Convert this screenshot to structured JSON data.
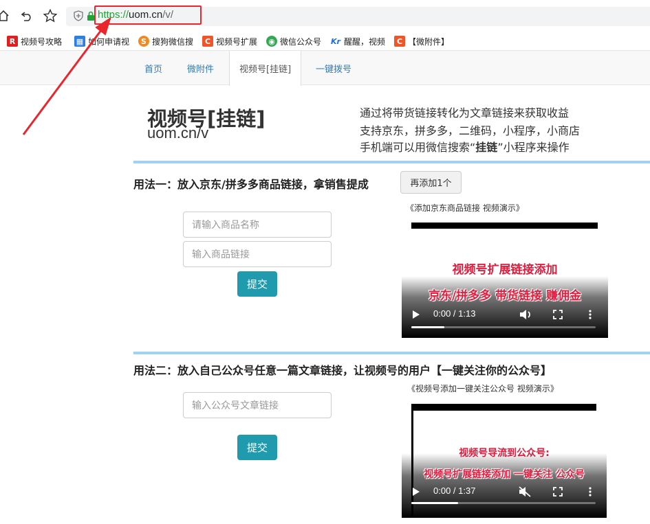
{
  "browser": {
    "url": {
      "scheme": "https://",
      "host": "uom.cn",
      "path": "/v/"
    },
    "bookmarks": [
      {
        "label": "视频号攻略",
        "icon": "R",
        "color": "#e02020"
      },
      {
        "label": "如何申请视",
        "icon": "▦",
        "color": "#2a7fe0"
      },
      {
        "label": "搜狗微信搜",
        "icon": "S",
        "color": "#f08a24"
      },
      {
        "label": "视频号扩展",
        "icon": "C",
        "color": "#f0552a"
      },
      {
        "label": "微信公众号",
        "icon": "◉",
        "color": "#34a853"
      },
      {
        "label": "醒醒，视频",
        "icon": "Kr",
        "color": "#1e6fd9"
      },
      {
        "label": "【微附件】",
        "icon": "C",
        "color": "#f0552a"
      }
    ]
  },
  "nav": {
    "tabs": [
      "首页",
      "微附件",
      "视频号[挂链]",
      "一键拨号"
    ],
    "active": 2
  },
  "header": {
    "title": "视频号[挂链]",
    "subtitle": "uom.cn/v",
    "intro": [
      "通过将带货链接转化为文章链接来获取收益",
      "支持京东，拼多多，二维码，小程序，小商店"
    ],
    "intro3": {
      "pre": "手机端可以用微信搜索“",
      "bold": "挂链",
      "post": "”小程序来操作"
    }
  },
  "method1": {
    "title": "用法一：放入京东/拼多多商品链接，拿销售提成",
    "add_button": "再添加1个",
    "name_placeholder": "请输入商品名称",
    "link_placeholder": "输入商品链接",
    "submit": "提交",
    "video_caption": "《添加京东商品链接 视频演示》",
    "video": {
      "line1": "视频号扩展链接添加",
      "line2": "京东/拼多多 带货链接 赚佣金",
      "time": "0:00 / 1:13",
      "progress": 0,
      "muted": false
    }
  },
  "method2": {
    "title": "用法二：放入自己公众号任意一篇文章链接，让视频号的用户【一键关注你的公众号】",
    "link_placeholder": "输入公众号文章链接",
    "submit": "提交",
    "video_caption": "《视频号添加一键关注公众号 视频演示》",
    "video": {
      "line1": "视频号导流到公众号:",
      "line2": "视频号扩展链接添加 一键关注 公众号",
      "time": "0:00 / 1:37",
      "progress": 0,
      "muted": true
    }
  },
  "colors": {
    "accent": "#1f9bad",
    "link": "#337ab7",
    "divider": "#9fd3f2",
    "highlight": "#e8262b"
  }
}
